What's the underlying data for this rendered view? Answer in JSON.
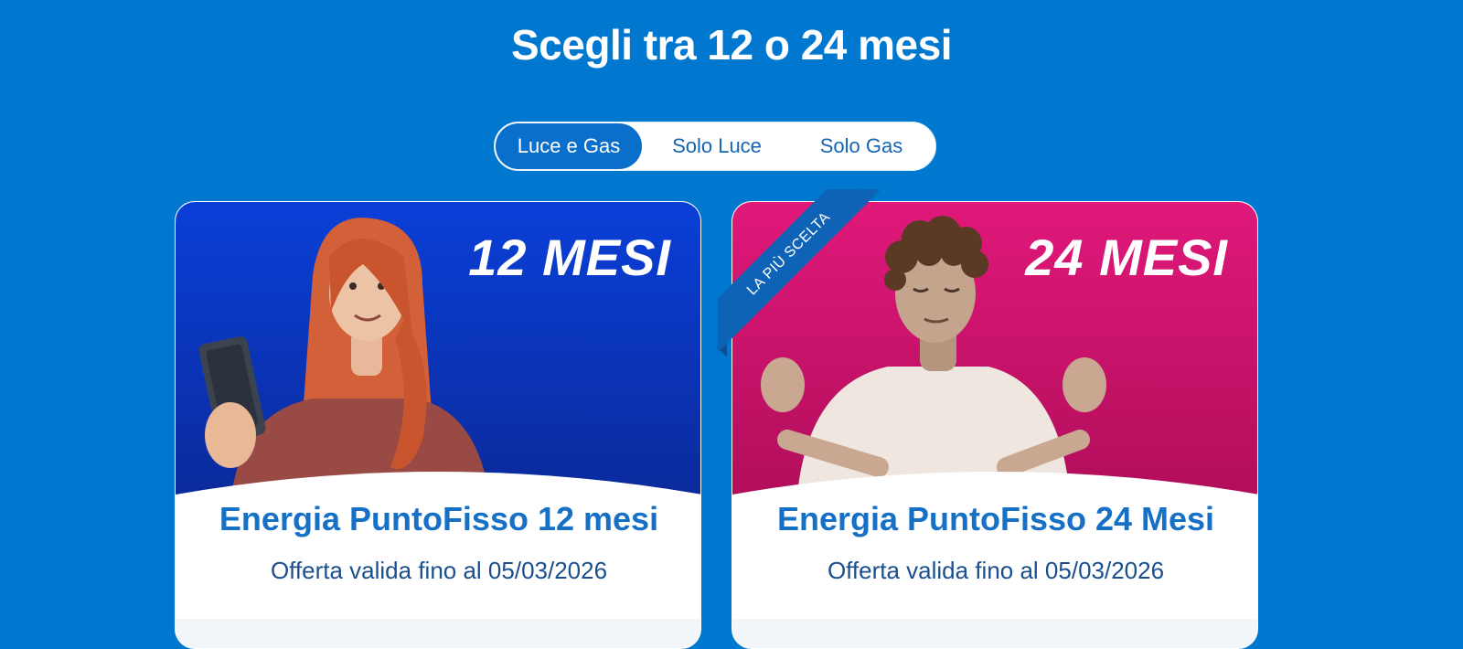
{
  "page": {
    "title": "Scegli tra 12 o 24 mesi"
  },
  "toggle": {
    "options": [
      {
        "label": "Luce e Gas",
        "active": true
      },
      {
        "label": "Solo Luce",
        "active": false
      },
      {
        "label": "Solo Gas",
        "active": false
      }
    ]
  },
  "cards": [
    {
      "badge": "12 MESI",
      "name": "Energia PuntoFisso 12 mesi",
      "validity": "Offerta valida fino al 05/03/2026",
      "bg_top": "#0a3fd8",
      "bg_bottom": "#0b2a9a",
      "illustration": "woman-with-phone-illustration"
    },
    {
      "badge": "24 MESI",
      "name": "Energia PuntoFisso 24 Mesi",
      "validity": "Offerta valida fino al 05/03/2026",
      "ribbon": "LA PIÙ SCELTA",
      "bg_top": "#e0187a",
      "bg_bottom": "#b00e5a",
      "illustration": "meditating-man-illustration"
    }
  ],
  "colors": {
    "page_bg": "#0078d0",
    "accent_blue": "#1570c6",
    "ribbon": "#0e63b7"
  }
}
